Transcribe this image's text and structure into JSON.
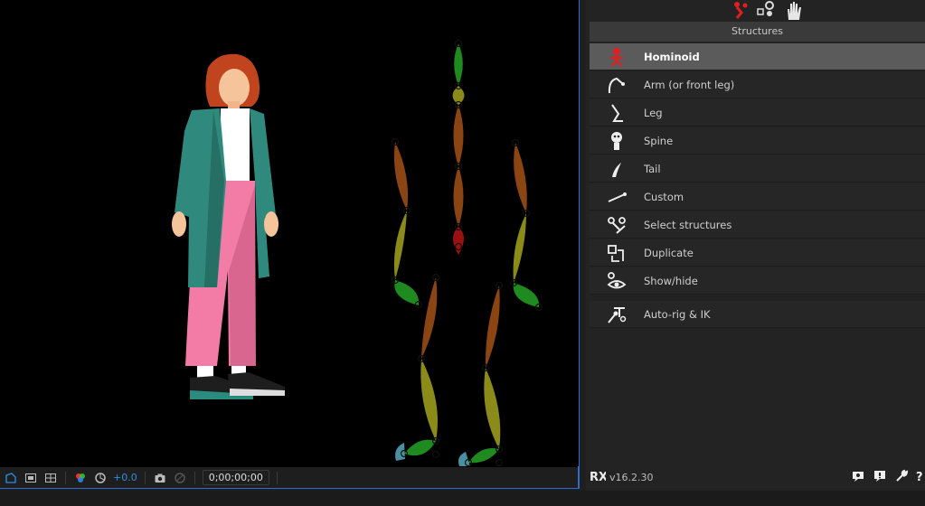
{
  "panel": {
    "section_title": "Structures",
    "items": [
      {
        "label": "Hominoid",
        "icon": "hominoid-icon",
        "selected": true
      },
      {
        "label": "Arm (or front leg)",
        "icon": "arm-icon"
      },
      {
        "label": "Leg",
        "icon": "leg-icon"
      },
      {
        "label": "Spine",
        "icon": "spine-icon"
      },
      {
        "label": "Tail",
        "icon": "tail-icon"
      },
      {
        "label": "Custom",
        "icon": "custom-bone-icon"
      },
      {
        "label": "Select structures",
        "icon": "select-structures-icon"
      },
      {
        "label": "Duplicate",
        "icon": "duplicate-icon"
      },
      {
        "label": "Show/hide",
        "icon": "show-hide-icon"
      }
    ],
    "autorig": {
      "label": "Auto-rig & IK",
      "icon": "autorig-icon"
    },
    "version": "v16.2.30"
  },
  "viewer": {
    "exposure": "+0.0",
    "timecode": "0;00;00;00"
  },
  "colors": {
    "accent_blue": "#2d6cd0",
    "selected_row": "#5b5b5b",
    "bone_orange": "#8b4513",
    "bone_olive": "#8b8b1a",
    "bone_green": "#1f8a1f",
    "bone_red": "#9b1010"
  }
}
